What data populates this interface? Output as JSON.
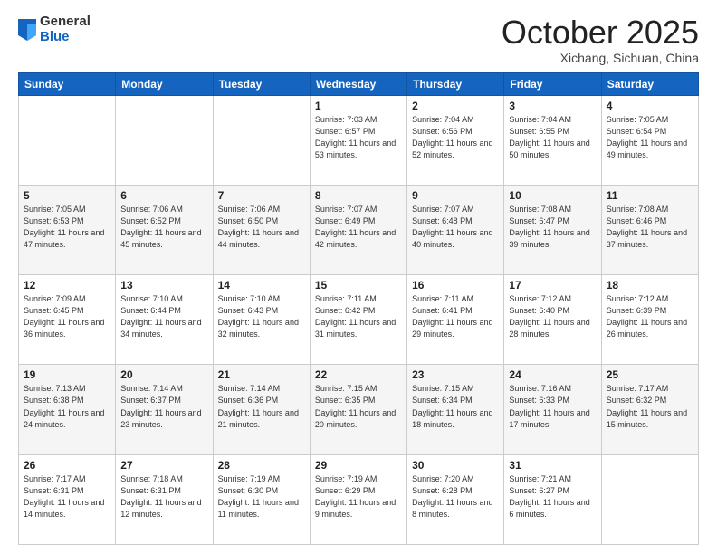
{
  "logo": {
    "general": "General",
    "blue": "Blue"
  },
  "header": {
    "month": "October 2025",
    "location": "Xichang, Sichuan, China"
  },
  "weekdays": [
    "Sunday",
    "Monday",
    "Tuesday",
    "Wednesday",
    "Thursday",
    "Friday",
    "Saturday"
  ],
  "weeks": [
    [
      {
        "day": "",
        "sunrise": "",
        "sunset": "",
        "daylight": ""
      },
      {
        "day": "",
        "sunrise": "",
        "sunset": "",
        "daylight": ""
      },
      {
        "day": "",
        "sunrise": "",
        "sunset": "",
        "daylight": ""
      },
      {
        "day": "1",
        "sunrise": "Sunrise: 7:03 AM",
        "sunset": "Sunset: 6:57 PM",
        "daylight": "Daylight: 11 hours and 53 minutes."
      },
      {
        "day": "2",
        "sunrise": "Sunrise: 7:04 AM",
        "sunset": "Sunset: 6:56 PM",
        "daylight": "Daylight: 11 hours and 52 minutes."
      },
      {
        "day": "3",
        "sunrise": "Sunrise: 7:04 AM",
        "sunset": "Sunset: 6:55 PM",
        "daylight": "Daylight: 11 hours and 50 minutes."
      },
      {
        "day": "4",
        "sunrise": "Sunrise: 7:05 AM",
        "sunset": "Sunset: 6:54 PM",
        "daylight": "Daylight: 11 hours and 49 minutes."
      }
    ],
    [
      {
        "day": "5",
        "sunrise": "Sunrise: 7:05 AM",
        "sunset": "Sunset: 6:53 PM",
        "daylight": "Daylight: 11 hours and 47 minutes."
      },
      {
        "day": "6",
        "sunrise": "Sunrise: 7:06 AM",
        "sunset": "Sunset: 6:52 PM",
        "daylight": "Daylight: 11 hours and 45 minutes."
      },
      {
        "day": "7",
        "sunrise": "Sunrise: 7:06 AM",
        "sunset": "Sunset: 6:50 PM",
        "daylight": "Daylight: 11 hours and 44 minutes."
      },
      {
        "day": "8",
        "sunrise": "Sunrise: 7:07 AM",
        "sunset": "Sunset: 6:49 PM",
        "daylight": "Daylight: 11 hours and 42 minutes."
      },
      {
        "day": "9",
        "sunrise": "Sunrise: 7:07 AM",
        "sunset": "Sunset: 6:48 PM",
        "daylight": "Daylight: 11 hours and 40 minutes."
      },
      {
        "day": "10",
        "sunrise": "Sunrise: 7:08 AM",
        "sunset": "Sunset: 6:47 PM",
        "daylight": "Daylight: 11 hours and 39 minutes."
      },
      {
        "day": "11",
        "sunrise": "Sunrise: 7:08 AM",
        "sunset": "Sunset: 6:46 PM",
        "daylight": "Daylight: 11 hours and 37 minutes."
      }
    ],
    [
      {
        "day": "12",
        "sunrise": "Sunrise: 7:09 AM",
        "sunset": "Sunset: 6:45 PM",
        "daylight": "Daylight: 11 hours and 36 minutes."
      },
      {
        "day": "13",
        "sunrise": "Sunrise: 7:10 AM",
        "sunset": "Sunset: 6:44 PM",
        "daylight": "Daylight: 11 hours and 34 minutes."
      },
      {
        "day": "14",
        "sunrise": "Sunrise: 7:10 AM",
        "sunset": "Sunset: 6:43 PM",
        "daylight": "Daylight: 11 hours and 32 minutes."
      },
      {
        "day": "15",
        "sunrise": "Sunrise: 7:11 AM",
        "sunset": "Sunset: 6:42 PM",
        "daylight": "Daylight: 11 hours and 31 minutes."
      },
      {
        "day": "16",
        "sunrise": "Sunrise: 7:11 AM",
        "sunset": "Sunset: 6:41 PM",
        "daylight": "Daylight: 11 hours and 29 minutes."
      },
      {
        "day": "17",
        "sunrise": "Sunrise: 7:12 AM",
        "sunset": "Sunset: 6:40 PM",
        "daylight": "Daylight: 11 hours and 28 minutes."
      },
      {
        "day": "18",
        "sunrise": "Sunrise: 7:12 AM",
        "sunset": "Sunset: 6:39 PM",
        "daylight": "Daylight: 11 hours and 26 minutes."
      }
    ],
    [
      {
        "day": "19",
        "sunrise": "Sunrise: 7:13 AM",
        "sunset": "Sunset: 6:38 PM",
        "daylight": "Daylight: 11 hours and 24 minutes."
      },
      {
        "day": "20",
        "sunrise": "Sunrise: 7:14 AM",
        "sunset": "Sunset: 6:37 PM",
        "daylight": "Daylight: 11 hours and 23 minutes."
      },
      {
        "day": "21",
        "sunrise": "Sunrise: 7:14 AM",
        "sunset": "Sunset: 6:36 PM",
        "daylight": "Daylight: 11 hours and 21 minutes."
      },
      {
        "day": "22",
        "sunrise": "Sunrise: 7:15 AM",
        "sunset": "Sunset: 6:35 PM",
        "daylight": "Daylight: 11 hours and 20 minutes."
      },
      {
        "day": "23",
        "sunrise": "Sunrise: 7:15 AM",
        "sunset": "Sunset: 6:34 PM",
        "daylight": "Daylight: 11 hours and 18 minutes."
      },
      {
        "day": "24",
        "sunrise": "Sunrise: 7:16 AM",
        "sunset": "Sunset: 6:33 PM",
        "daylight": "Daylight: 11 hours and 17 minutes."
      },
      {
        "day": "25",
        "sunrise": "Sunrise: 7:17 AM",
        "sunset": "Sunset: 6:32 PM",
        "daylight": "Daylight: 11 hours and 15 minutes."
      }
    ],
    [
      {
        "day": "26",
        "sunrise": "Sunrise: 7:17 AM",
        "sunset": "Sunset: 6:31 PM",
        "daylight": "Daylight: 11 hours and 14 minutes."
      },
      {
        "day": "27",
        "sunrise": "Sunrise: 7:18 AM",
        "sunset": "Sunset: 6:31 PM",
        "daylight": "Daylight: 11 hours and 12 minutes."
      },
      {
        "day": "28",
        "sunrise": "Sunrise: 7:19 AM",
        "sunset": "Sunset: 6:30 PM",
        "daylight": "Daylight: 11 hours and 11 minutes."
      },
      {
        "day": "29",
        "sunrise": "Sunrise: 7:19 AM",
        "sunset": "Sunset: 6:29 PM",
        "daylight": "Daylight: 11 hours and 9 minutes."
      },
      {
        "day": "30",
        "sunrise": "Sunrise: 7:20 AM",
        "sunset": "Sunset: 6:28 PM",
        "daylight": "Daylight: 11 hours and 8 minutes."
      },
      {
        "day": "31",
        "sunrise": "Sunrise: 7:21 AM",
        "sunset": "Sunset: 6:27 PM",
        "daylight": "Daylight: 11 hours and 6 minutes."
      },
      {
        "day": "",
        "sunrise": "",
        "sunset": "",
        "daylight": ""
      }
    ]
  ]
}
